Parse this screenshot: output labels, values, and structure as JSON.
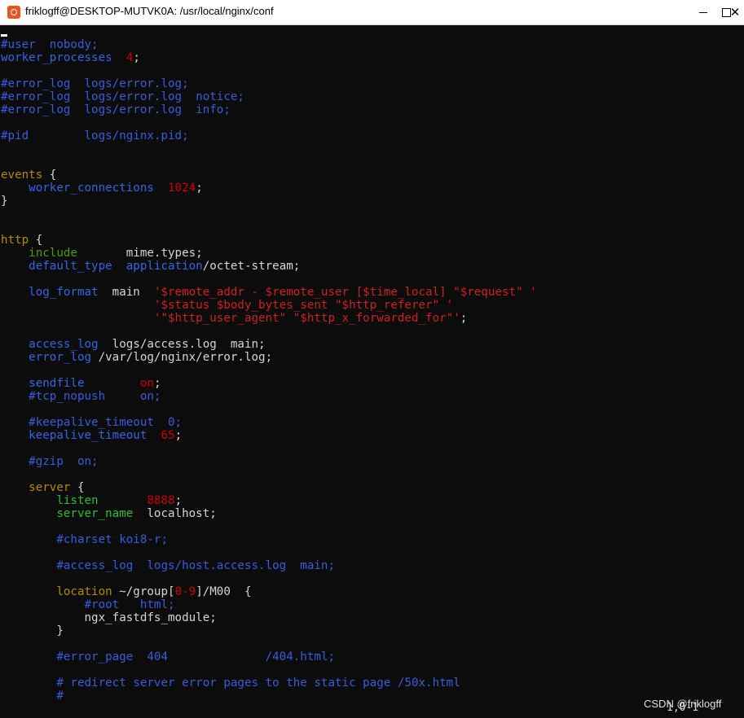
{
  "window": {
    "title": "friklogff@DESKTOP-MUTVK0A: /usr/local/nginx/conf",
    "minimize": "",
    "maximize": "",
    "close": "✕"
  },
  "terminal": {
    "lines": [
      {
        "t": 0,
        "segs": [
          [
            "cm",
            "#user  nobody;"
          ]
        ]
      },
      {
        "t": 1,
        "segs": [
          [
            "blu",
            "worker_processes"
          ],
          [
            "txt",
            "  "
          ],
          [
            "num",
            "4"
          ],
          [
            "txt",
            ";"
          ]
        ]
      },
      {
        "t": 3,
        "segs": [
          [
            "cm",
            "#error_log  logs/error.log;"
          ]
        ]
      },
      {
        "t": 4,
        "segs": [
          [
            "cm",
            "#error_log  logs/error.log  notice;"
          ]
        ]
      },
      {
        "t": 5,
        "segs": [
          [
            "cm",
            "#error_log  logs/error.log  info;"
          ]
        ]
      },
      {
        "t": 7,
        "segs": [
          [
            "cm",
            "#pid        logs/nginx.pid;"
          ]
        ]
      },
      {
        "t": 10,
        "segs": [
          [
            "kwo",
            "events"
          ],
          [
            "txt",
            " {"
          ]
        ]
      },
      {
        "t": 11,
        "segs": [
          [
            "txt",
            "    "
          ],
          [
            "blu",
            "worker_connections"
          ],
          [
            "txt",
            "  "
          ],
          [
            "num",
            "1024"
          ],
          [
            "txt",
            ";"
          ]
        ]
      },
      {
        "t": 12,
        "segs": [
          [
            "txt",
            "}"
          ]
        ]
      },
      {
        "t": 15,
        "segs": [
          [
            "kwo",
            "http"
          ],
          [
            "txt",
            " {"
          ]
        ]
      },
      {
        "t": 16,
        "segs": [
          [
            "txt",
            "    "
          ],
          [
            "inc",
            "include"
          ],
          [
            "txt",
            "       mime.types;"
          ]
        ]
      },
      {
        "t": 17,
        "segs": [
          [
            "txt",
            "    "
          ],
          [
            "blu",
            "default_type"
          ],
          [
            "txt",
            "  "
          ],
          [
            "blu",
            "application"
          ],
          [
            "txt",
            "/octet-stream;"
          ]
        ]
      },
      {
        "t": 19,
        "segs": [
          [
            "txt",
            "    "
          ],
          [
            "blu",
            "log_format"
          ],
          [
            "txt",
            "  main  "
          ],
          [
            "str",
            "'$remote_addr - $remote_user [$time_local] \"$request\" '"
          ]
        ]
      },
      {
        "t": 20,
        "segs": [
          [
            "txt",
            "                      "
          ],
          [
            "str",
            "'$status $body_bytes_sent \"$http_referer\" '"
          ]
        ]
      },
      {
        "t": 21,
        "segs": [
          [
            "txt",
            "                      "
          ],
          [
            "str",
            "'\"$http_user_agent\" \"$http_x_forwarded_for\"'"
          ],
          [
            "txt",
            ";"
          ]
        ]
      },
      {
        "t": 23,
        "segs": [
          [
            "txt",
            "    "
          ],
          [
            "blu",
            "access_log"
          ],
          [
            "txt",
            "  logs/access.log  main;"
          ]
        ]
      },
      {
        "t": 24,
        "segs": [
          [
            "txt",
            "    "
          ],
          [
            "blu",
            "error_log"
          ],
          [
            "txt",
            " /var/log/nginx/error.log;"
          ]
        ]
      },
      {
        "t": 26,
        "segs": [
          [
            "txt",
            "    "
          ],
          [
            "blu",
            "sendfile"
          ],
          [
            "txt",
            "        "
          ],
          [
            "num",
            "on"
          ],
          [
            "txt",
            ";"
          ]
        ]
      },
      {
        "t": 27,
        "segs": [
          [
            "txt",
            "    "
          ],
          [
            "cm",
            "#tcp_nopush     on;"
          ]
        ]
      },
      {
        "t": 29,
        "segs": [
          [
            "txt",
            "    "
          ],
          [
            "cm",
            "#keepalive_timeout  0;"
          ]
        ]
      },
      {
        "t": 30,
        "segs": [
          [
            "txt",
            "    "
          ],
          [
            "blu",
            "keepalive_timeout"
          ],
          [
            "txt",
            "  "
          ],
          [
            "num",
            "65"
          ],
          [
            "txt",
            ";"
          ]
        ]
      },
      {
        "t": 32,
        "segs": [
          [
            "txt",
            "    "
          ],
          [
            "cm",
            "#gzip  on;"
          ]
        ]
      },
      {
        "t": 34,
        "segs": [
          [
            "txt",
            "    "
          ],
          [
            "kwo",
            "server"
          ],
          [
            "txt",
            " {"
          ]
        ]
      },
      {
        "t": 35,
        "segs": [
          [
            "txt",
            "        "
          ],
          [
            "grn",
            "listen"
          ],
          [
            "txt",
            "       "
          ],
          [
            "num",
            "8888"
          ],
          [
            "txt",
            ";"
          ]
        ]
      },
      {
        "t": 36,
        "segs": [
          [
            "txt",
            "        "
          ],
          [
            "grn",
            "server_name"
          ],
          [
            "txt",
            "  localhost;"
          ]
        ]
      },
      {
        "t": 38,
        "segs": [
          [
            "txt",
            "        "
          ],
          [
            "cm",
            "#charset koi8-r;"
          ]
        ]
      },
      {
        "t": 40,
        "segs": [
          [
            "txt",
            "        "
          ],
          [
            "cm",
            "#access_log  logs/host.access.log  main;"
          ]
        ]
      },
      {
        "t": 42,
        "segs": [
          [
            "txt",
            "        "
          ],
          [
            "kwo",
            "location"
          ],
          [
            "txt",
            " ~/group["
          ],
          [
            "num",
            "0-9"
          ],
          [
            "txt",
            "]/M00  {"
          ]
        ]
      },
      {
        "t": 43,
        "segs": [
          [
            "txt",
            "            "
          ],
          [
            "cm",
            "#root   html;"
          ]
        ]
      },
      {
        "t": 44,
        "segs": [
          [
            "txt",
            "            ngx_fastdfs_module;"
          ]
        ]
      },
      {
        "t": 45,
        "segs": [
          [
            "txt",
            "        }"
          ]
        ]
      },
      {
        "t": 47,
        "segs": [
          [
            "txt",
            "        "
          ],
          [
            "cm",
            "#error_page  404              /404.html;"
          ]
        ]
      },
      {
        "t": 49,
        "segs": [
          [
            "txt",
            "        "
          ],
          [
            "cm",
            "# redirect server error pages to the static page /50x.html"
          ]
        ]
      },
      {
        "t": 50,
        "segs": [
          [
            "txt",
            "        "
          ],
          [
            "cm",
            "#"
          ]
        ]
      }
    ],
    "status": "1,0-1",
    "watermark": "CSDN @friklogff"
  },
  "colors": {
    "comment": "#3b5bdb",
    "keyword": "#b58900",
    "directive": "#3465e4",
    "number": "#cc0000",
    "text": "#d3d7cf",
    "background": "#0c0c0c"
  }
}
